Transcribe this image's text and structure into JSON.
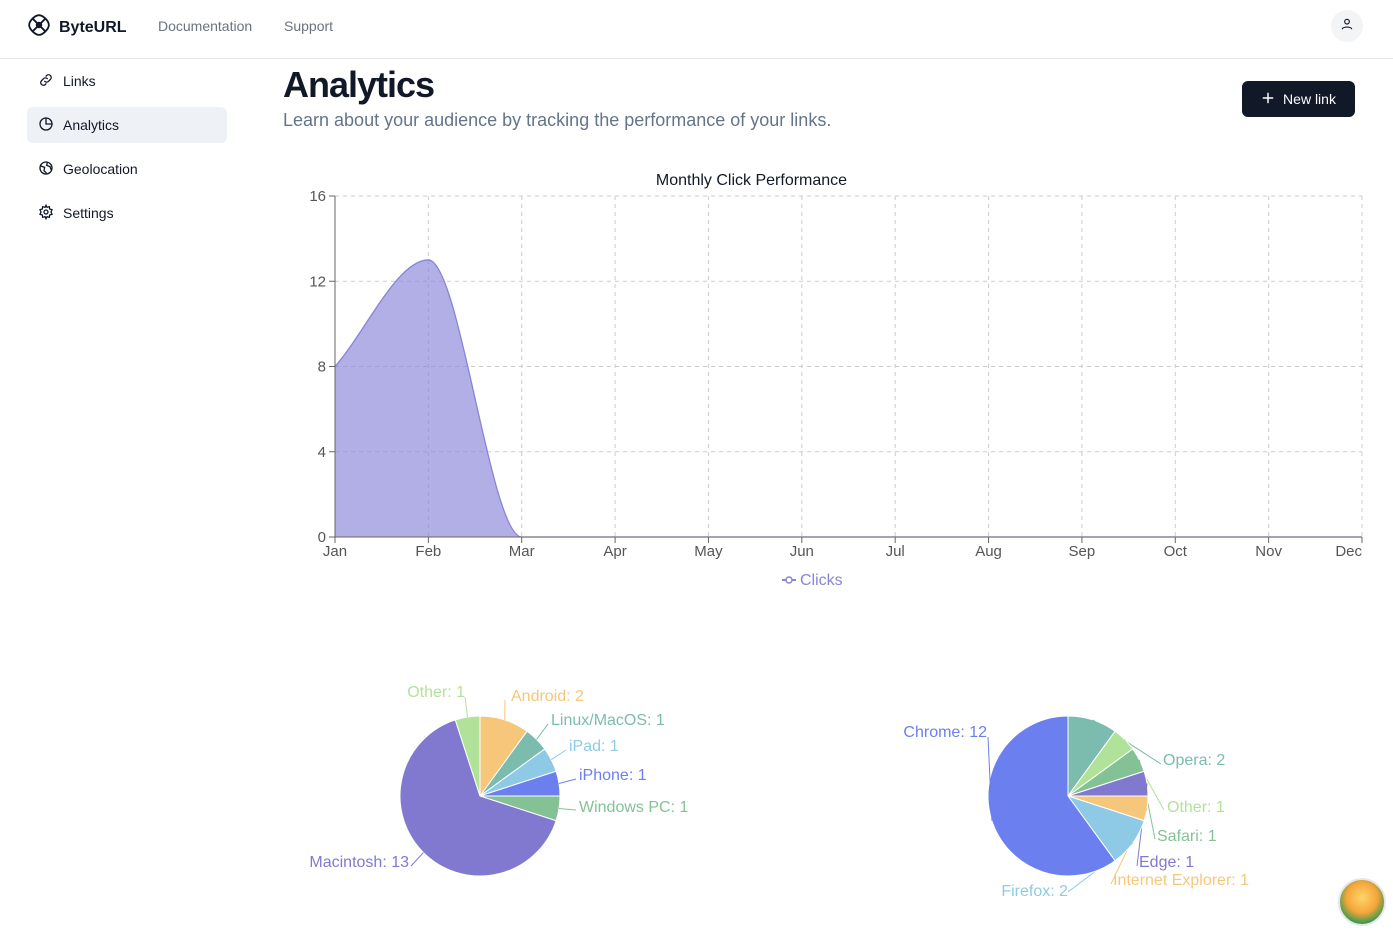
{
  "app": {
    "brand_name": "ByteURL",
    "nav": [
      "Documentation",
      "Support"
    ]
  },
  "sidebar": {
    "items": [
      {
        "label": "Links",
        "icon": "link-icon"
      },
      {
        "label": "Analytics",
        "icon": "pie-chart-icon",
        "active": true
      },
      {
        "label": "Geolocation",
        "icon": "globe-icon"
      },
      {
        "label": "Settings",
        "icon": "gear-icon"
      }
    ]
  },
  "page": {
    "title": "Analytics",
    "subtitle": "Learn about your audience by tracking the performance of your links.",
    "new_link_label": "New link"
  },
  "colors": {
    "area_fill": "#8884d8",
    "primary_button": "#111827"
  },
  "chart_data": [
    {
      "type": "area",
      "title": "Monthly Click Performance",
      "categories": [
        "Jan",
        "Feb",
        "Mar",
        "Apr",
        "May",
        "Jun",
        "Jul",
        "Aug",
        "Sep",
        "Oct",
        "Nov",
        "Dec"
      ],
      "series": [
        {
          "name": "Clicks",
          "values": [
            8,
            13,
            0,
            0,
            0,
            0,
            0,
            0,
            0,
            0,
            0,
            0
          ],
          "color": "#8884d8"
        }
      ],
      "yticks": [
        0,
        4,
        8,
        12,
        16
      ],
      "ylim": [
        0,
        16
      ],
      "grid": true,
      "legend": "bottom"
    },
    {
      "type": "pie",
      "slices": [
        {
          "label": "Android",
          "value": 2,
          "color": "#f6c77a"
        },
        {
          "label": "Linux/MacOS",
          "value": 1,
          "color": "#7bbcae"
        },
        {
          "label": "iPad",
          "value": 1,
          "color": "#8ecae6"
        },
        {
          "label": "iPhone",
          "value": 1,
          "color": "#6c7fee"
        },
        {
          "label": "Windows PC",
          "value": 1,
          "color": "#84c295"
        },
        {
          "label": "Macintosh",
          "value": 13,
          "color": "#8179cf"
        },
        {
          "label": "Other",
          "value": 1,
          "color": "#b1e29a"
        }
      ]
    },
    {
      "type": "pie",
      "slices": [
        {
          "label": "Opera",
          "value": 2,
          "color": "#7bbcae"
        },
        {
          "label": "Other",
          "value": 1,
          "color": "#b1e29a"
        },
        {
          "label": "Safari",
          "value": 1,
          "color": "#84c295"
        },
        {
          "label": "Edge",
          "value": 1,
          "color": "#8179cf"
        },
        {
          "label": "Internet Explorer",
          "value": 1,
          "color": "#f6c77a"
        },
        {
          "label": "Firefox",
          "value": 2,
          "color": "#8ecae6"
        },
        {
          "label": "Chrome",
          "value": 12,
          "color": "#6c7fee"
        }
      ]
    }
  ]
}
